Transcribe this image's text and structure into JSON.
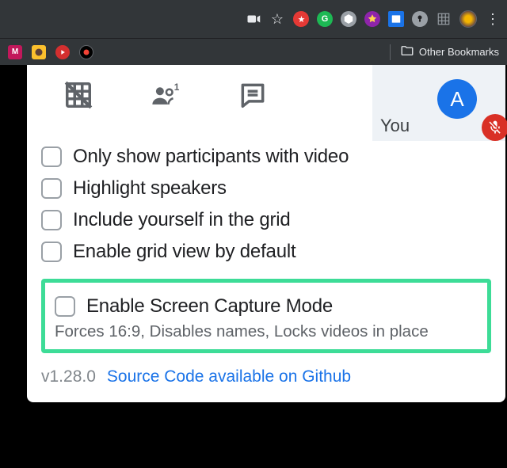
{
  "browser": {
    "other_bookmarks_label": "Other Bookmarks"
  },
  "meet": {
    "you_label": "You",
    "avatar_initial": "A"
  },
  "options": [
    {
      "label": "Only show participants with video"
    },
    {
      "label": "Highlight speakers"
    },
    {
      "label": "Include yourself in the grid"
    },
    {
      "label": "Enable grid view by default"
    }
  ],
  "highlight": {
    "label": "Enable Screen Capture Mode",
    "description": "Forces 16:9, Disables names, Locks videos in place"
  },
  "footer": {
    "version": "v1.28.0",
    "source_link_label": "Source Code available on Github"
  }
}
